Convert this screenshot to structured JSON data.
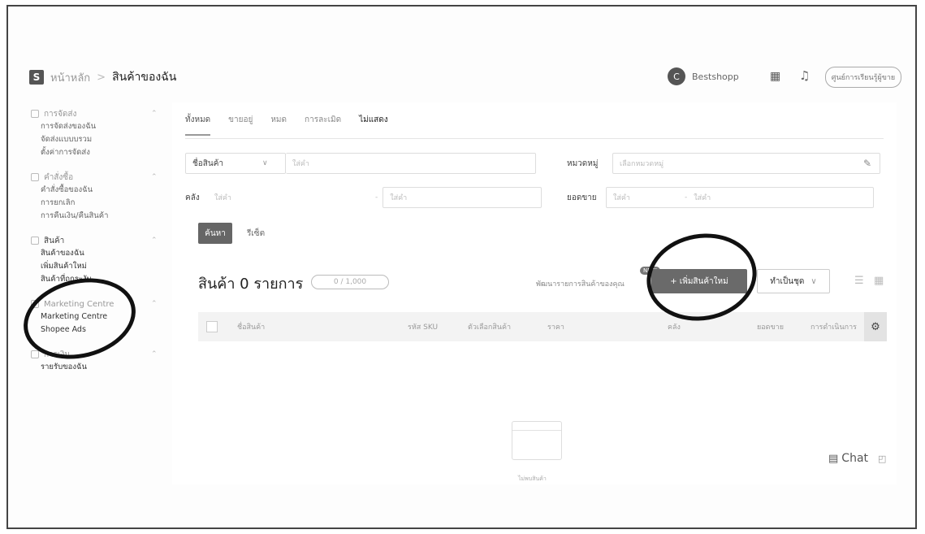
{
  "topbar": {
    "logo": "S",
    "breadcrumb_home": "หน้าหลัก",
    "breadcrumb_sep": ">",
    "breadcrumb_current": "สินค้าของฉัน",
    "avatar_letter": "C",
    "shop_name": "Bestshopp",
    "grid_icon": "apps-grid-icon",
    "bell_icon": "bell-icon",
    "help_button": "ศูนย์การเรียนรู้ผู้ขาย"
  },
  "sidebar": {
    "sections": [
      {
        "title": "การจัดส่ง",
        "items": [
          "การจัดส่งของฉัน",
          "จัดส่งแบบบรวม",
          "ตั้งค่าการจัดส่ง"
        ]
      },
      {
        "title": "คำสั่งซื้อ",
        "items": [
          "คำสั่งซื้อของฉัน",
          "การยกเลิก",
          "การคืนเงิน/คืนสินค้า"
        ]
      },
      {
        "title": "สินค้า",
        "items": [
          "สินค้าของฉัน",
          "เพิ่มสินค้าใหม่",
          "สินค้าที่ถูกระงับ"
        ]
      },
      {
        "title": "Marketing Centre",
        "items": [
          "Marketing Centre",
          "Shopee Ads"
        ]
      },
      {
        "title": "การเงิน",
        "items": [
          "รายรับของฉัน"
        ]
      }
    ]
  },
  "tabs": [
    "ทั้งหมด",
    "ขายอยู่",
    "หมด",
    "การละเมิด",
    "ไม่แสดง"
  ],
  "filters": {
    "product_name_select": "ชื่อสินค้า",
    "product_name_placeholder": "ใส่คำ",
    "category_label": "หมวดหมู่",
    "category_placeholder": "เลือกหมวดหมู่",
    "stock_label": "คลัง",
    "stock_min_placeholder": "ใส่คำ",
    "stock_max_placeholder": "ใส่คำ",
    "sales_label": "ยอดขาย",
    "sales_min_placeholder": "ใส่คำ",
    "sales_range_sep": "-",
    "sales_max_placeholder": "ใส่คำ"
  },
  "actions": {
    "search": "ค้นหา",
    "reset": "รีเซ็ต"
  },
  "listing": {
    "count_title": "สินค้า 0 รายการ",
    "count_limit": "0 / 1,000",
    "analyze_link": "พัฒนารายการสินค้าของคุณ",
    "new_badge": "NEW",
    "add_button": "+ เพิ่มสินค้าใหม่",
    "bulk_button": "ทำเป็นชุด",
    "list_view_icon": "list-view-icon",
    "grid_view_icon": "grid-view-icon"
  },
  "table": {
    "columns": [
      "ชื่อสินค้า",
      "รหัส SKU",
      "ตัวเลือกสินค้า",
      "ราคา",
      "คลัง",
      "ยอดขาย",
      "การดำเนินการ"
    ],
    "settings_icon": "column-settings-icon",
    "empty_text": "ไม่พบสินค้า"
  },
  "chat": {
    "label": "Chat",
    "icon": "chat-icon",
    "minimize_icon": "minimize-icon"
  }
}
